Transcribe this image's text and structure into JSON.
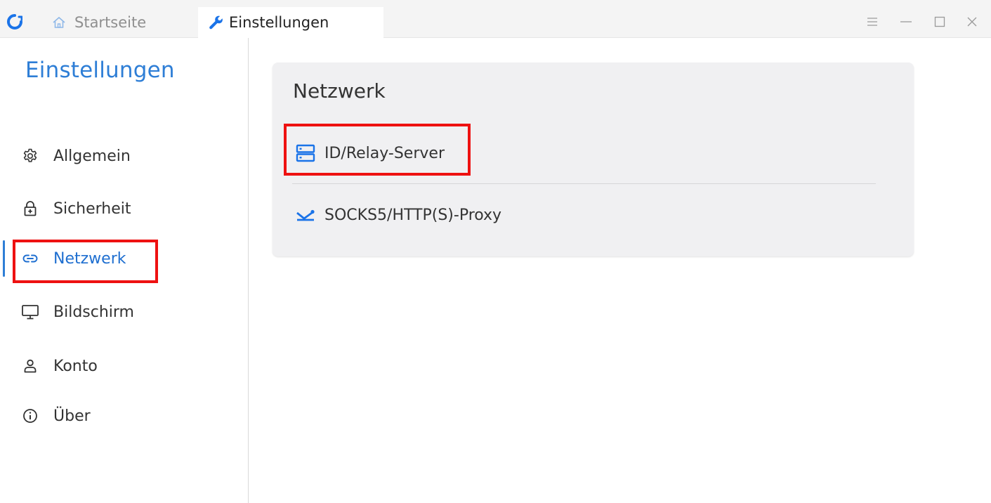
{
  "window": {
    "tabs": [
      {
        "label": "Startseite",
        "icon": "home-icon"
      },
      {
        "label": "Einstellungen",
        "icon": "wrench-icon"
      }
    ],
    "controls": [
      "menu-icon",
      "minimize-icon",
      "maximize-icon",
      "close-icon"
    ]
  },
  "sidebar": {
    "title": "Einstellungen",
    "items": [
      {
        "label": "Allgemein",
        "icon": "gear-icon"
      },
      {
        "label": "Sicherheit",
        "icon": "lock-icon"
      },
      {
        "label": "Netzwerk",
        "icon": "link-icon",
        "active": true
      },
      {
        "label": "Bildschirm",
        "icon": "monitor-icon"
      },
      {
        "label": "Konto",
        "icon": "user-icon"
      },
      {
        "label": "Über",
        "icon": "info-icon"
      }
    ]
  },
  "main": {
    "section_title": "Netzwerk",
    "items": [
      {
        "label": "ID/Relay-Server",
        "icon": "server-icon"
      },
      {
        "label": "SOCKS5/HTTP(S)-Proxy",
        "icon": "proxy-icon"
      }
    ]
  },
  "colors": {
    "accent": "#2e7ed6",
    "highlight": "#ee1111"
  }
}
